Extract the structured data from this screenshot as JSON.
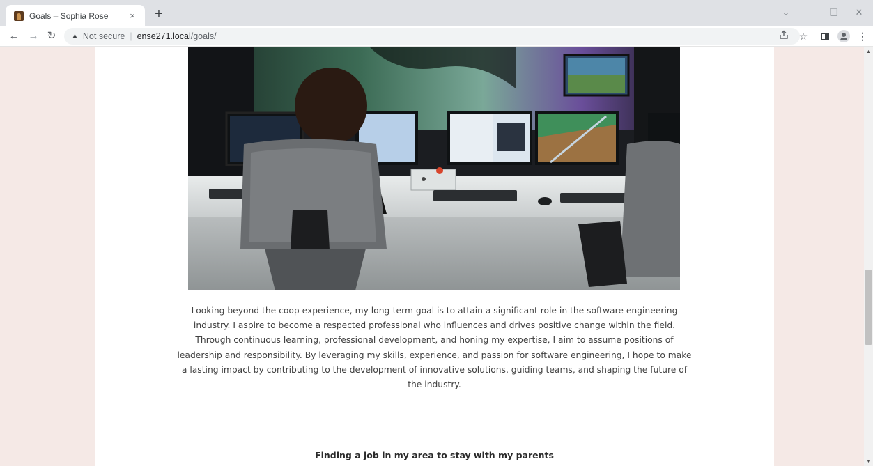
{
  "browser": {
    "tab_title": "Goals – Sophia Rose",
    "tab_close": "×",
    "new_tab": "+",
    "address": {
      "security_label": "Not secure",
      "separator": "|",
      "host": "ense271.local",
      "path": "/goals/"
    },
    "icons": [
      "favicon-icon",
      "back-arrow-icon",
      "forward-arrow-icon",
      "reload-icon",
      "warning-icon",
      "share-icon",
      "star-icon",
      "side-panel-icon",
      "profile-icon",
      "kebab-menu-icon",
      "chevron-down-icon",
      "minimize-icon",
      "restore-icon",
      "close-icon"
    ]
  },
  "page": {
    "hero_image": {
      "description_icon": "control-room-photo"
    },
    "paragraph": "Looking beyond the coop experience, my long-term goal is to attain a significant role in the software engineering industry. I aspire to become a respected professional who influences and drives positive change within the field. Through continuous learning, professional development, and honing my expertise, I aim to assume positions of leadership and responsibility. By leveraging my skills, experience, and passion for software engineering, I hope to make a lasting impact by contributing to the development of innovative solutions, guiding teams, and shaping the future of the industry.",
    "next_heading": "Finding a job in my area to stay with my parents"
  },
  "colors": {
    "side_background": "#f5e9e6",
    "content_background": "#ffffff",
    "text": "#414141",
    "heading": "#2a2a2a"
  }
}
